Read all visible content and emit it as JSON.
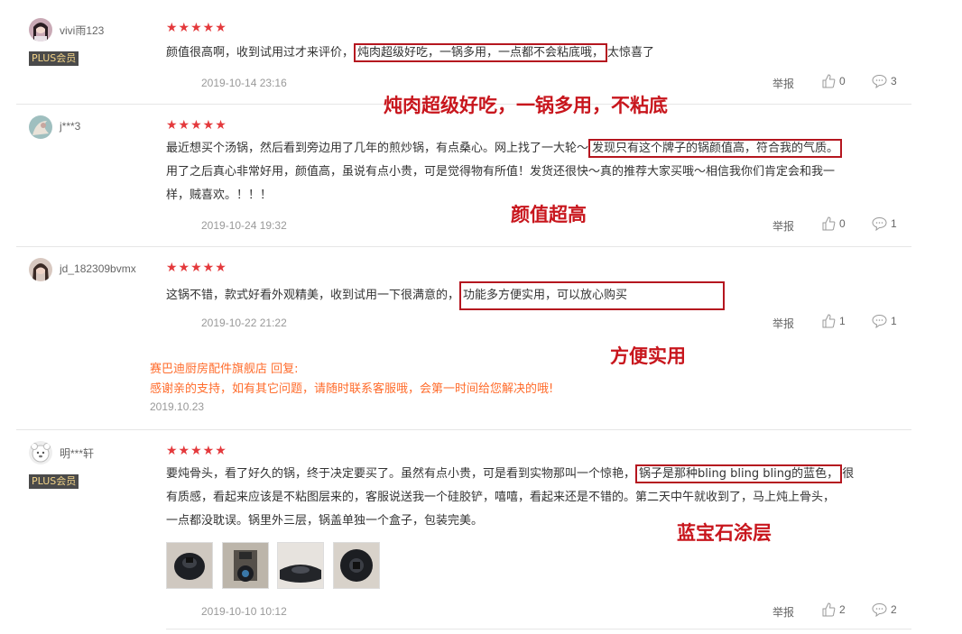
{
  "reviews": [
    {
      "user": "vivi雨123",
      "badge": "PLUS会员",
      "stars": "★★★★★",
      "text_before": "颜值很高啊，收到试用过才来评价，",
      "text_highlight": "炖肉超级好吃，一锅多用，一点都不会粘底哦，",
      "text_after": "太惊喜了",
      "date": "2019-10-14 23:16",
      "report": "举报",
      "likes": "0",
      "comments": "3",
      "callout": "炖肉超级好吃，一锅多用，不粘底"
    },
    {
      "user": "j***3",
      "stars": "★★★★★",
      "text_line1_before": "最近想买个汤锅，然后看到旁边用了几年的煎炒锅，有点桑心。网上找了一大轮～",
      "text_highlight": "发现只有这个牌子的锅颜值高，符合我的气质。",
      "text_line2": "用了之后真心非常好用，颜值高，虽说有点小贵，可是觉得物有所值！发货还很快～真的推荐大家买哦～相信我你们肯定会和我一",
      "text_line3": "样，贼喜欢。！！！",
      "date": "2019-10-24 19:32",
      "report": "举报",
      "likes": "0",
      "comments": "1",
      "callout": "颜值超高"
    },
    {
      "user": "jd_182309bvmx",
      "stars": "★★★★★",
      "text_before": "这锅不错，款式好看外观精美，收到试用一下很满意的，",
      "text_highlight": "功能多方便实用，可以放心购买",
      "date": "2019-10-22 21:22",
      "report": "举报",
      "likes": "1",
      "comments": "1",
      "callout": "方便实用",
      "reply_head": "赛巴迪厨房配件旗舰店 回复:",
      "reply_text": "感谢亲的支持，如有其它问题，请随时联系客服哦，会第一时间给您解决的哦!",
      "reply_date": "2019.10.23"
    },
    {
      "user": "明***轩",
      "badge": "PLUS会员",
      "stars": "★★★★★",
      "text_line1_before": "要炖骨头，看了好久的锅，终于决定要买了。虽然有点小贵，可是看到实物那叫一个惊艳，",
      "text_highlight": "锅子是那种bling bling bling的蓝色，",
      "text_line1_after": "很",
      "text_line2": "有质感，看起来应该是不粘图层来的，客服说送我一个硅胶铲，嘻嘻，看起来还是不错的。第二天中午就收到了，马上炖上骨头，",
      "text_line3": "一点都没耽误。锅里外三层，锅盖单独一个盒子，包装完美。",
      "date": "2019-10-10 10:12",
      "report": "举报",
      "likes": "2",
      "comments": "2",
      "callout": "蓝宝石涂层"
    }
  ]
}
